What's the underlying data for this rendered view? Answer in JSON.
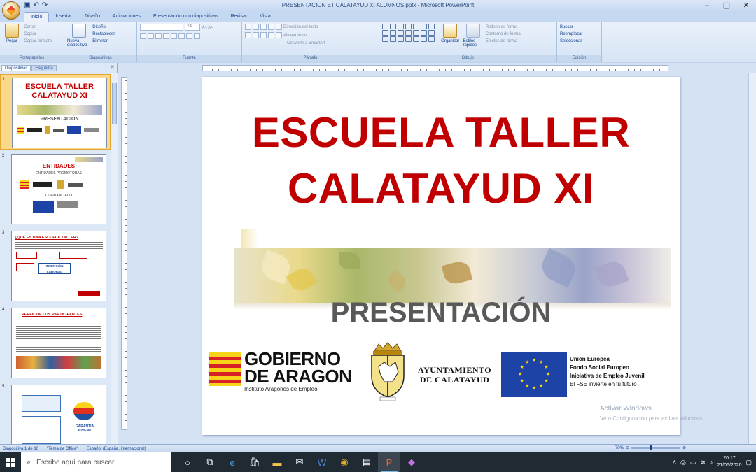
{
  "window": {
    "title": "PRESENTACION ET CALATAYUD XI ALUMNOS.pptx - Microsoft PowerPoint",
    "controls": [
      "–",
      "▢",
      "✕"
    ]
  },
  "ribbon_tabs": [
    "Inicio",
    "Insertar",
    "Diseño",
    "Animaciones",
    "Presentación con diapositivas",
    "Revisar",
    "Vista"
  ],
  "ribbon": {
    "clipboard": {
      "paste": "Pegar",
      "cut": "Cortar",
      "copy": "Copiar",
      "format_painter": "Copiar formato",
      "label": "Portapapeles"
    },
    "slides": {
      "new_slide": "Nueva diapositiva",
      "layout": "Diseño",
      "reset": "Restablecer",
      "delete": "Eliminar",
      "label": "Diapositivas"
    },
    "font": {
      "size": "24",
      "label": "Fuente"
    },
    "paragraph": {
      "text_direction": "Dirección del texto",
      "align_text": "Alinear texto",
      "smartart": "Convertir a SmartArt",
      "label": "Párrafo"
    },
    "drawing": {
      "arrange": "Organizar",
      "quick_styles": "Estilos rápidos",
      "shape_fill": "Relleno de forma",
      "shape_outline": "Contorno de forma",
      "shape_effects": "Efectos de forma",
      "label": "Dibujo"
    },
    "editing": {
      "find": "Buscar",
      "replace": "Reemplazar",
      "select": "Seleccionar",
      "label": "Edición"
    }
  },
  "pane_tabs": [
    "Diapositivas",
    "Esquema"
  ],
  "thumbnails": [
    {
      "num": "1",
      "title": "ESCUELA TALLER CALATAYUD XI",
      "sub": "PRESENTACIÓN"
    },
    {
      "num": "2",
      "title": "ENTIDADES",
      "sub": "ENTIDADES PROMOTORAS",
      "sub2": "COFINANCIADO"
    },
    {
      "num": "3",
      "title": "¿QUÉ ES UNA ESCUELA TALLER?",
      "sub": "INSERCIÓN LABORAL"
    },
    {
      "num": "4",
      "title": "PERFIL DE LOS PARTICIPANTES"
    },
    {
      "num": "5",
      "title": "GARANTÍA JUVENIL"
    }
  ],
  "slide": {
    "title_line1": "ESCUELA TALLER",
    "title_line2": "CALATAYUD XI",
    "subtitle": "PRESENTACIÓN",
    "aragon_line1": "GOBIERNO",
    "aragon_line2": "DE ARAGON",
    "aragon_sub": "Instituto Aragonés de Empleo",
    "ayto_line1": "AYUNTAMIENTO",
    "ayto_line2": "DE CALATAYUD",
    "eu_line1": "Unión Europea",
    "eu_line2": "Fondo Social Europeo",
    "eu_line3": "Iniciativa de Empleo Juvenil",
    "eu_line4": "El FSE invierte en tu futuro"
  },
  "watermark": {
    "line1": "Activar Windows",
    "line2": "Ve a Configuración para activar Windows."
  },
  "statusbar": {
    "slide_info": "Diapositiva 1 de 10",
    "theme": "\"Tema de Office\"",
    "language": "Español (España, internacional)",
    "zoom": "70%"
  },
  "taskbar": {
    "search_placeholder": "Escribe aquí para buscar",
    "time": "20:17",
    "date": "21/06/2020"
  },
  "colors": {
    "title_red": "#c00000",
    "subtitle_gray": "#595959",
    "ribbon_blue": "#15428b"
  }
}
